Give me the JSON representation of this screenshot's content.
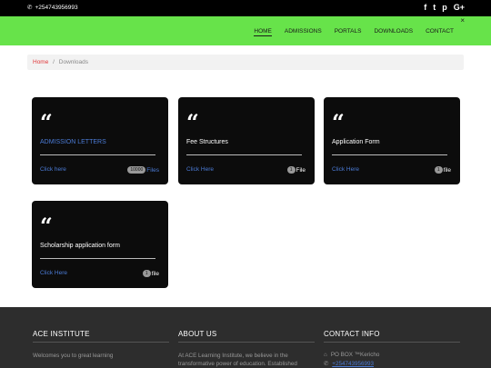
{
  "topbar": {
    "phone": "+254743956993",
    "social": [
      "f",
      "t",
      "p",
      "G+"
    ]
  },
  "nav": {
    "items": [
      "HOME",
      "ADMISSIONS",
      "PORTALS",
      "DOWNLOADS",
      "CONTACT"
    ],
    "close": "×"
  },
  "breadcrumb": {
    "home": "Home",
    "sep": "/",
    "current": "Downloads"
  },
  "cards": [
    {
      "quote": "66",
      "title": "ADMISSION LETTERS",
      "link": "Click here",
      "badge": "10000",
      "count_label": "Files"
    },
    {
      "quote": "66",
      "title": "Fee Structures",
      "link": "Click Here",
      "badge": "1",
      "count_label": "File"
    },
    {
      "quote": "66",
      "title": "Application Form",
      "link": "Click Here",
      "badge": "1",
      "count_label": "file"
    },
    {
      "quote": "66",
      "title": "Scholarship application form",
      "link": "Click Here",
      "badge": "1",
      "count_label": "file"
    }
  ],
  "footer": {
    "col1": {
      "title": "ACE INSTITUTE",
      "text": "Welcomes you to great learning"
    },
    "col2": {
      "title": "ABOUT US",
      "text1": "At ACE Learning Institute, we believe in the",
      "text2": "transformative power of education. Established"
    },
    "col3": {
      "title": "CONTACT INFO",
      "address": "PO BOX ™Kericho",
      "phone": "+254743956993"
    }
  }
}
